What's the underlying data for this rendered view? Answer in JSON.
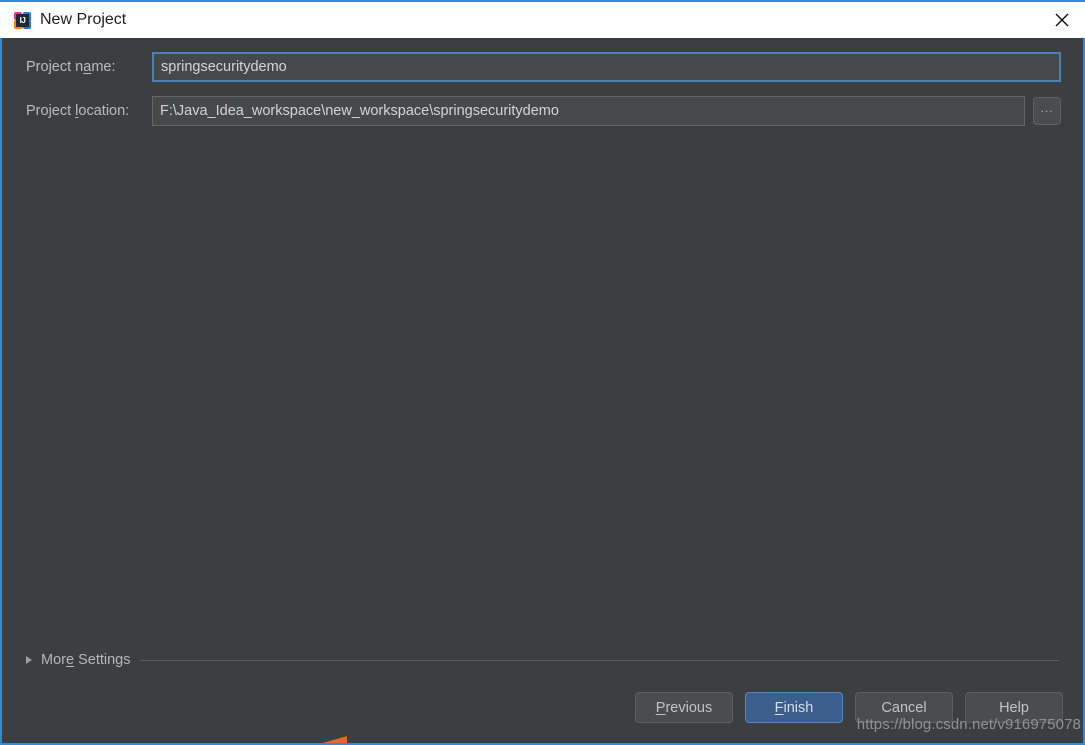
{
  "window": {
    "title": "New Project",
    "app_icon": "intellij-idea-icon",
    "icon_letters": "IJ",
    "close_icon": "close-icon",
    "accent_border_color": "#2e8bd8",
    "background_color": "#3c3f41",
    "titlebar_background": "#ffffff"
  },
  "form": {
    "project_name": {
      "label_before": "Project n",
      "label_mnemonic": "a",
      "label_after": "me:",
      "value": "springsecuritydemo",
      "placeholder": "",
      "focused": true
    },
    "project_location": {
      "label_before": "Project ",
      "label_mnemonic": "l",
      "label_after": "ocation:",
      "value": "F:\\Java_Idea_workspace\\new_workspace\\springsecuritydemo",
      "placeholder": "",
      "focused": false
    },
    "browse_button": {
      "label": "...",
      "name": "browse-button"
    }
  },
  "more_settings": {
    "label_before": "Mor",
    "label_mnemonic": "e",
    "label_after": " Settings",
    "expanded": false,
    "twisty_icon": "chevron-right-icon"
  },
  "footer": {
    "buttons": [
      {
        "name": "previous-button",
        "before": "",
        "mnemonic": "P",
        "after": "revious",
        "default": false
      },
      {
        "name": "finish-button",
        "before": "",
        "mnemonic": "F",
        "after": "inish",
        "default": true
      },
      {
        "name": "cancel-button",
        "before": "Cancel",
        "mnemonic": "",
        "after": "",
        "default": false
      },
      {
        "name": "help-button",
        "before": "Help",
        "mnemonic": "",
        "after": "",
        "default": false
      }
    ],
    "default_button_color": "#3b5e8c"
  },
  "watermark": {
    "text": "https://blog.csdn.net/v916975078"
  }
}
